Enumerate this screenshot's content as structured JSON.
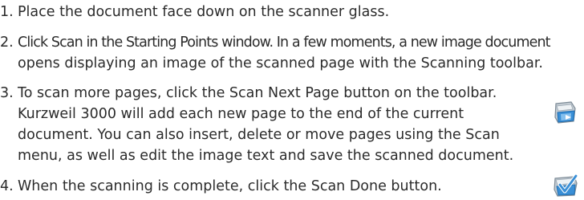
{
  "steps": [
    {
      "number": "1.",
      "lines": [
        "Place the document face down on the scanner glass."
      ]
    },
    {
      "number": "2.",
      "lines": [
        "Click Scan in the Starting Points window. In a few moments, a new image document",
        "opens displaying an image of the scanned page with the Scanning toolbar."
      ]
    },
    {
      "number": "3.",
      "lines": [
        "To scan more pages, click the Scan Next Page button on the toolbar.",
        "Kurzweil 3000 will add each new page to the end of the current",
        "document. You can also insert, delete or move pages using the Scan",
        "menu, as well as edit the image text and save the scanned document."
      ]
    },
    {
      "number": "4.",
      "lines": [
        "When the scanning is complete, click the Scan Done button."
      ]
    }
  ],
  "icons": {
    "scan_next_page": "scan-next-page-icon",
    "scan_done": "scan-done-icon",
    "accent_blue": "#3a8fd6",
    "accent_gray": "#7e8c98"
  }
}
